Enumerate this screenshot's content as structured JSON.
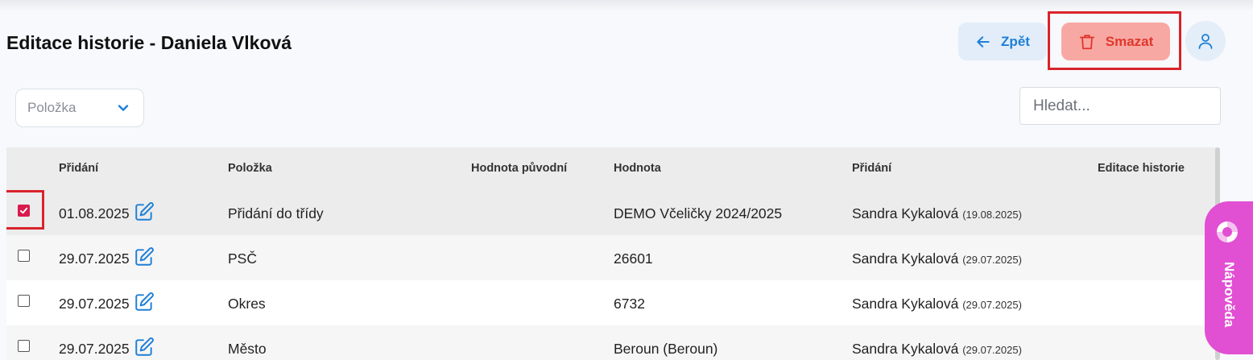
{
  "header": {
    "title": "Editace historie - Daniela Vlková",
    "back_label": "Zpět",
    "delete_label": "Smazat"
  },
  "filters": {
    "item_select_placeholder": "Položka",
    "search_placeholder": "Hledat..."
  },
  "table": {
    "columns": [
      "Přidání",
      "Položka",
      "Hodnota původní",
      "Hodnota",
      "Přidání",
      "Editace historie"
    ],
    "rows": [
      {
        "checked": true,
        "date": "01.08.2025",
        "item": "Přidání do třídy",
        "original": "",
        "value": "DEMO Včeličky 2024/2025",
        "added_by": "Sandra Kykalová",
        "added_date": "(19.08.2025)"
      },
      {
        "checked": false,
        "date": "29.07.2025",
        "item": "PSČ",
        "original": "",
        "value": "26601",
        "added_by": "Sandra Kykalová",
        "added_date": "(29.07.2025)"
      },
      {
        "checked": false,
        "date": "29.07.2025",
        "item": "Okres",
        "original": "",
        "value": "6732",
        "added_by": "Sandra Kykalová",
        "added_date": "(29.07.2025)"
      },
      {
        "checked": false,
        "date": "29.07.2025",
        "item": "Město",
        "original": "",
        "value": "Beroun (Beroun)",
        "added_by": "Sandra Kykalová",
        "added_date": "(29.07.2025)"
      }
    ]
  },
  "help": {
    "label": "Nápověda"
  },
  "colors": {
    "accent_blue": "#1e7fd6",
    "delete_bg": "#f8a8a3",
    "delete_text": "#e0372c",
    "checkbox_checked": "#d81b4d",
    "help_tab": "#e14fd3",
    "highlight_red": "#d9232b"
  }
}
